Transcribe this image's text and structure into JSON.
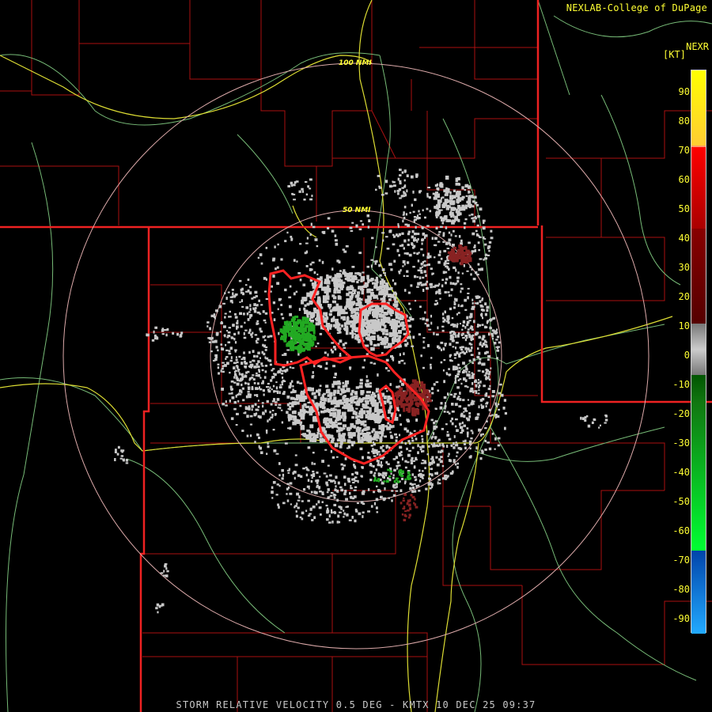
{
  "credit": "NEXLAB-College of DuPage",
  "product_code": "NEXR",
  "unit_label": "[KT]",
  "footer_title": "STORM RELATIVE VELOCITY 0.5 DEG - KMTX 10 DEC 25 09:37",
  "range_rings": [
    {
      "label": "50 NMI"
    },
    {
      "label": "100 NMI"
    }
  ],
  "legend": {
    "ticks": [
      "90",
      "80",
      "70",
      "60",
      "50",
      "40",
      "30",
      "20",
      "10",
      "0",
      "-10",
      "-20",
      "-30",
      "-40",
      "-50",
      "-60",
      "-70",
      "-80",
      "-90"
    ],
    "colors": {
      "top": "#ffff00",
      "orange": "#ff9966",
      "red": "#ff0000",
      "dark_red": "#550000",
      "neutral": "#cccccc",
      "dark_green": "#005500",
      "green": "#00ff33",
      "blue": "#0044aa",
      "light_blue": "#22aaff"
    }
  },
  "map_colors": {
    "state_border": "#ee2222",
    "county_border": "#aa1111",
    "highway": "#dddd33",
    "road": "#77bb77",
    "ring": "#ddaaaa",
    "warning_polygon": "#ff2222",
    "echo_neutral": "#c8c8c8",
    "echo_inbound": "#22aa22",
    "echo_outbound": "#882222"
  }
}
